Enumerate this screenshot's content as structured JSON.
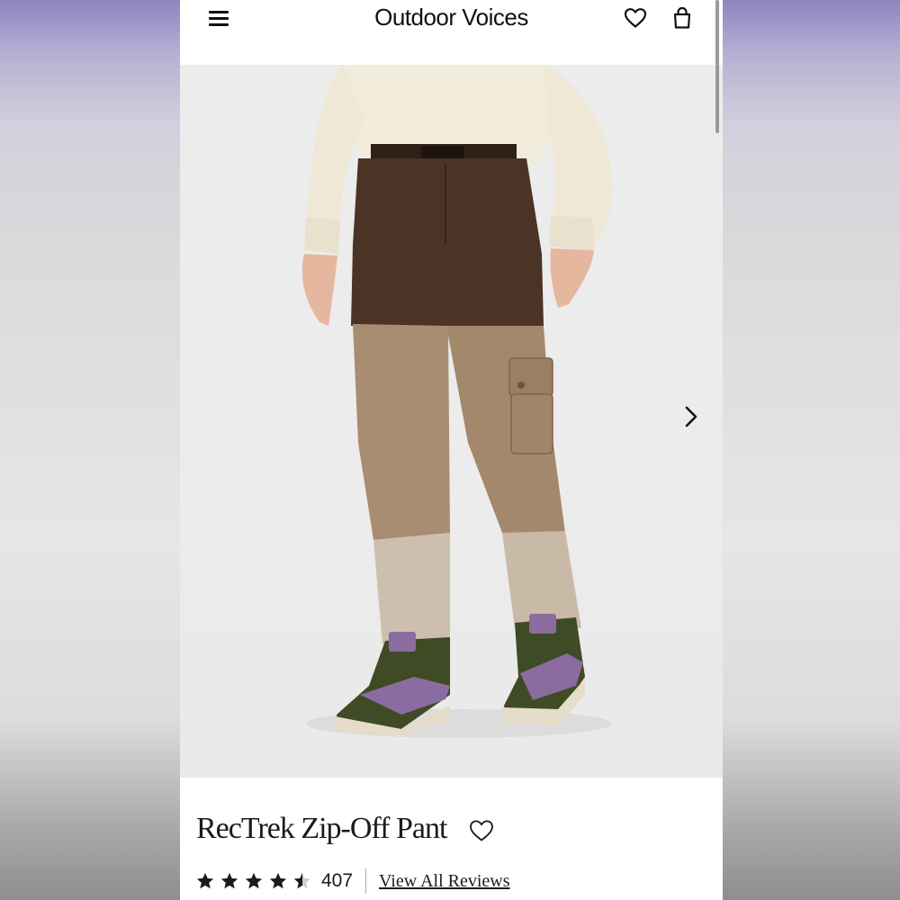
{
  "header": {
    "brand": "Outdoor Voices",
    "menu_icon": "menu-icon",
    "wishlist_icon": "heart-icon",
    "bag_icon": "shopping-bag-icon"
  },
  "gallery": {
    "image_alt": "Model wearing brown and tan zip-off pants with cream sweater and hiking shoes",
    "next_icon": "chevron-right-icon"
  },
  "product": {
    "title": "RecTrek Zip-Off Pant",
    "wishlist_icon": "heart-icon",
    "rating": 4.5,
    "review_count": "407",
    "reviews_link": "View All Reviews"
  },
  "colors": {
    "text": "#1b1b1b",
    "pant_top": "#4b3325",
    "pant_mid": "#a88d72",
    "pant_bottom": "#cdbfad",
    "sweater": "#f1ebda",
    "shoe_olive": "#5a5f2e",
    "shoe_purple": "#8a6ca0"
  }
}
